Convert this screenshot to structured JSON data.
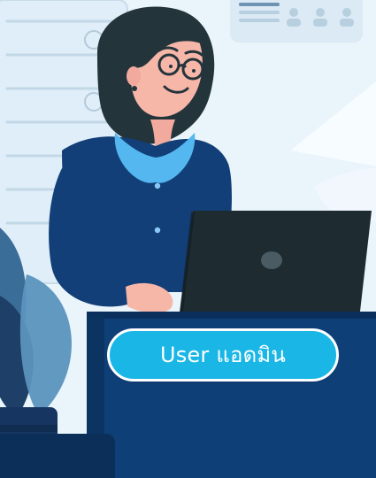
{
  "cta": {
    "label": "User แอดมิน"
  },
  "illustration": {
    "subject": "woman-working-on-laptop",
    "icons": [
      "person-icon",
      "person-icon",
      "person-icon"
    ],
    "colors": {
      "background_light": "#e8f3fa",
      "panel": "#cfe6f3",
      "shirt": "#123f77",
      "collar": "#54b7f0",
      "hair": "#23343b",
      "skin": "#f6b6a8",
      "laptop": "#1e2b31",
      "desk": "#0f3f77",
      "plant_dark": "#1e3f67",
      "plant_mid": "#3a6d98",
      "button": "#19b6e6"
    }
  }
}
